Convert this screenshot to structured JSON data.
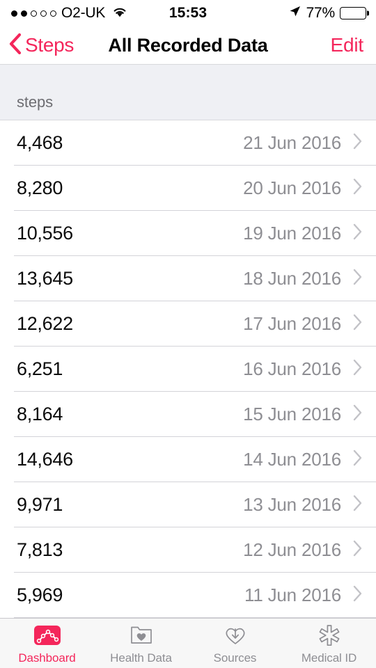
{
  "status_bar": {
    "carrier": "O2-UK",
    "signal_bars_filled": 2,
    "signal_bars_total": 5,
    "wifi_icon": "wifi-icon",
    "time": "15:53",
    "location_icon": "location-arrow-icon",
    "battery_percent": "77%",
    "battery_level": 77
  },
  "nav_bar": {
    "back_icon": "chevron-left-icon",
    "back_label": "Steps",
    "title": "All Recorded Data",
    "edit_label": "Edit"
  },
  "list": {
    "section_header": "steps",
    "rows": [
      {
        "value": "4,468",
        "date": "21 Jun 2016"
      },
      {
        "value": "8,280",
        "date": "20 Jun 2016"
      },
      {
        "value": "10,556",
        "date": "19 Jun 2016"
      },
      {
        "value": "13,645",
        "date": "18 Jun 2016"
      },
      {
        "value": "12,622",
        "date": "17 Jun 2016"
      },
      {
        "value": "6,251",
        "date": "16 Jun 2016"
      },
      {
        "value": "8,164",
        "date": "15 Jun 2016"
      },
      {
        "value": "14,646",
        "date": "14 Jun 2016"
      },
      {
        "value": "9,971",
        "date": "13 Jun 2016"
      },
      {
        "value": "7,813",
        "date": "12 Jun 2016"
      },
      {
        "value": "5,969",
        "date": "11 Jun 2016"
      }
    ]
  },
  "tab_bar": {
    "tabs": [
      {
        "label": "Dashboard",
        "icon": "dashboard-chart-icon",
        "active": true
      },
      {
        "label": "Health Data",
        "icon": "folder-heart-icon",
        "active": false
      },
      {
        "label": "Sources",
        "icon": "heart-download-icon",
        "active": false
      },
      {
        "label": "Medical ID",
        "icon": "star-of-life-icon",
        "active": false
      }
    ]
  },
  "colors": {
    "accent": "#f4265b",
    "secondary_text": "#8e8e93",
    "separator": "#d3d3d8",
    "section_bg": "#eff0f4",
    "tabbar_bg": "#f7f7f7"
  }
}
